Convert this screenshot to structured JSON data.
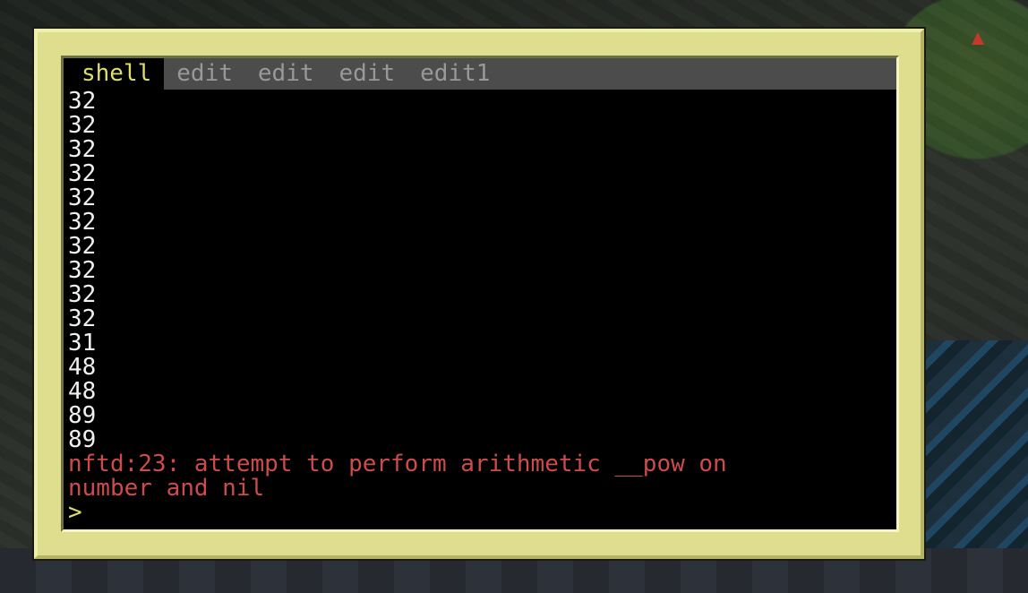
{
  "tabs": [
    {
      "label": "shell"
    },
    {
      "label": "edit"
    },
    {
      "label": "edit"
    },
    {
      "label": "edit"
    },
    {
      "label": "edit1"
    }
  ],
  "console": {
    "output": [
      "32",
      "32",
      "32",
      "32",
      "32",
      "32",
      "32",
      "32",
      "32",
      "32",
      "31",
      "48",
      "48",
      "89",
      "89"
    ],
    "error": [
      "nftd:23: attempt to perform arithmetic __pow on",
      "number and nil"
    ],
    "prompt": ">",
    "input_value": ""
  },
  "colors": {
    "frame": "#dede8e",
    "screen": "#000000",
    "tabbar": "#4c4c4c",
    "active_tab_text": "#dede6c",
    "inactive_tab_text": "#999999",
    "output_text": "#f0f0f0",
    "error_text": "#cc4c4c"
  }
}
